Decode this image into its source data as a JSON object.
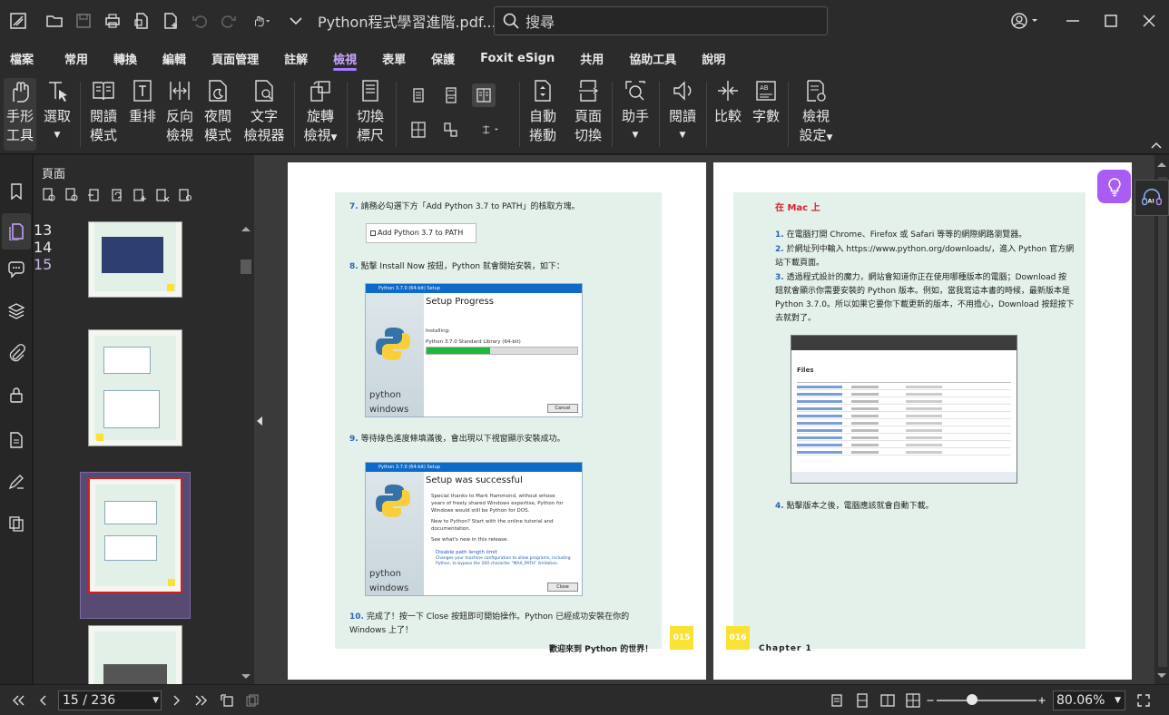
{
  "titlebar": {
    "document_title": "Python程式學習進階.pdf...",
    "search_placeholder": "搜尋"
  },
  "menu": {
    "items": [
      "檔案",
      "常用",
      "轉換",
      "編輯",
      "頁面管理",
      "註解",
      "檢視",
      "表單",
      "保護",
      "Foxit eSign",
      "共用",
      "協助工具",
      "說明"
    ],
    "active": "檢視"
  },
  "ribbon": {
    "hand_tool": [
      "手形",
      "工具"
    ],
    "select": [
      "選取"
    ],
    "reading_mode": [
      "閱讀",
      "模式"
    ],
    "reflow": [
      "重排"
    ],
    "reverse_view": [
      "反向",
      "檢視"
    ],
    "night_mode": [
      "夜間",
      "模式"
    ],
    "text_viewer": [
      "文字",
      "檢視器"
    ],
    "rotate_view": [
      "旋轉",
      "檢視"
    ],
    "toggle_ruler": [
      "切換",
      "標尺"
    ],
    "auto_scroll": [
      "自動",
      "捲動"
    ],
    "page_transition": [
      "頁面",
      "切換"
    ],
    "assistant": [
      "助手"
    ],
    "read_aloud": [
      "閱讀"
    ],
    "compare": [
      "比較"
    ],
    "word_count": [
      "字數"
    ],
    "view_settings": [
      "檢視",
      "設定"
    ]
  },
  "thumbnails": {
    "panel_title": "頁面",
    "pages": [
      {
        "number": "13"
      },
      {
        "number": "14"
      },
      {
        "number": "15"
      }
    ]
  },
  "left_page": {
    "step7_num": "7.",
    "step7_text": "請務必勾選下方「Add Python 3.7 to PATH」的核取方塊。",
    "checkbox_label": "Add Python 3.7 to PATH",
    "step8_num": "8.",
    "step8_text": "點擊 Install Now 按鈕，Python 就會開始安裝，如下：",
    "shot1_title": "Python 3.7.0 (64-bit) Setup",
    "shot1_heading": "Setup Progress",
    "shot1_line1": "Installing:",
    "shot1_line2": "Python 3.7.0 Standard Library (64-bit)",
    "shot1_progress": 0.42,
    "shot1_cancel": "Cancel",
    "python_word": "python",
    "windows_word": "windows",
    "step9_num": "9.",
    "step9_text": "等待綠色進度條填滿後，會出現以下視窗顯示安裝成功。",
    "shot2_title": "Python 3.7.0 (64-bit) Setup",
    "shot2_heading": "Setup was successful",
    "shot2_p1": "Special thanks to Mark Hammond, without whose years of freely shared Windows expertise, Python for Windows would still be Python for DOS.",
    "shot2_p2": "New to Python? Start with the online tutorial and documentation.",
    "shot2_p3": "See what's new in this release.",
    "shot2_p4": "Disable path length limit",
    "shot2_p5": "Changes your machine configuration to allow programs, including Python, to bypass the 260 character \"MAX_PATH\" limitation.",
    "shot2_close": "Close",
    "step10_num": "10.",
    "step10_text": "完成了！按一下 Close 按鈕即可開始操作。Python 已經成功安裝在你的 Windows 上了！",
    "footer_text": "歡迎來到 Python 的世界！",
    "page_badge": "015"
  },
  "right_page": {
    "heading": "在 Mac 上",
    "step1_num": "1.",
    "step1_text": "在電腦打開 Chrome、Firefox 或 Safari 等等的網際網路瀏覽器。",
    "step2_num": "2.",
    "step2_text": "於網址列中輸入 https://www.python.org/downloads/，進入 Python 官方網站下載頁面。",
    "step3_num": "3.",
    "step3_text": "透過程式設計的魔力，網站會知道你正在使用哪種版本的電腦；Download 按鈕就會顯示你需要安裝的 Python 版本。例如，當我寫這本書的時候，最新版本是 Python 3.7.0。所以如果它要你下載更新的版本，不用擔心，Download 按鈕按下去就對了。",
    "browser_heading": "Files",
    "step4_num": "4.",
    "step4_text": "點擊版本之後，電腦應該就會自動下載。",
    "footer_text": "Chapter 1",
    "page_badge": "016"
  },
  "statusbar": {
    "page_indicator": "15 / 236",
    "zoom": "80.06%",
    "zoom_level": 0.35
  },
  "colors": {
    "accent": "#a779ff",
    "page_bg": "#e3f1ea",
    "badge": "#f9e135",
    "heading_red": "#d6202a",
    "step_blue": "#2d62b8"
  }
}
